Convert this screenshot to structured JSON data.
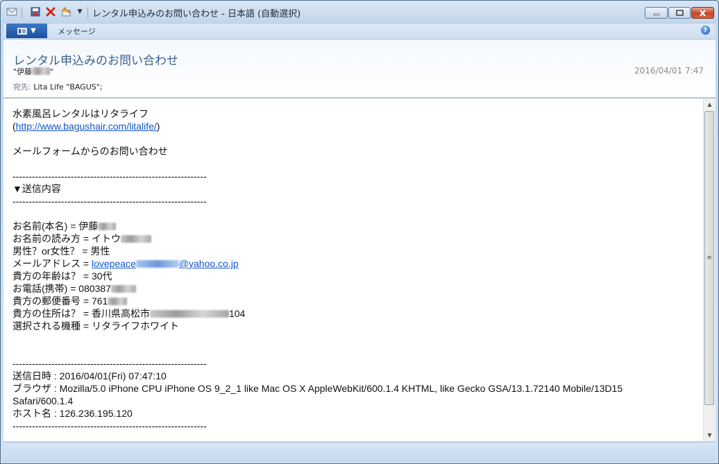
{
  "window": {
    "title": "レンタル申込みのお問い合わせ - 日本語 (自動選択)"
  },
  "menu": {
    "tab_message": "メッセージ",
    "help": "?"
  },
  "header": {
    "subject": "レンタル申込みのお問い合わせ",
    "from_prefix": "\"伊藤",
    "from_suffix": "\"",
    "date": "2016/04/01 7:47",
    "to_label": "宛先:",
    "to_value": "Lita Life \"BAGUS\";"
  },
  "body": {
    "line_intro": "水素風呂レンタルはリタライフ",
    "link_open": "(",
    "link_url": "http://www.bagushair.com/litalife/",
    "link_close": ")",
    "line_form": "メールフォームからのお問い合わせ",
    "rule": "------------------------------------------------------------",
    "section_title": "▼送信内容",
    "name_prefix": "お名前(本名) = 伊藤",
    "reading_prefix": "お名前の読み方 = イトウ",
    "gender": "男性？or女性？ = 男性",
    "email_label": "メールアドレス = ",
    "email_prefix": "lovepeace",
    "email_suffix": "@yahoo.co.jp",
    "age": "貴方の年齢は？ = 30代",
    "phone_prefix": "お電話(携帯) = 080387",
    "zip_prefix": "貴方の郵便番号 = 761",
    "address_prefix": "貴方の住所は？ = 香川県高松市",
    "address_suffix": "104",
    "model": "選択される機種 = リタライフホワイト",
    "sent_at": "送信日時 : 2016/04/01(Fri) 07:47:10",
    "browser_1": "ブラウザ : Mozilla/5.0 iPhone CPU iPhone OS 9_2_1 like Mac OS X AppleWebKit/600.1.4 KHTML, like Gecko GSA/13.1.72140 Mobile/13D15",
    "browser_2": "Safari/600.1.4",
    "host": "ホスト名 : 126.236.195.120"
  }
}
